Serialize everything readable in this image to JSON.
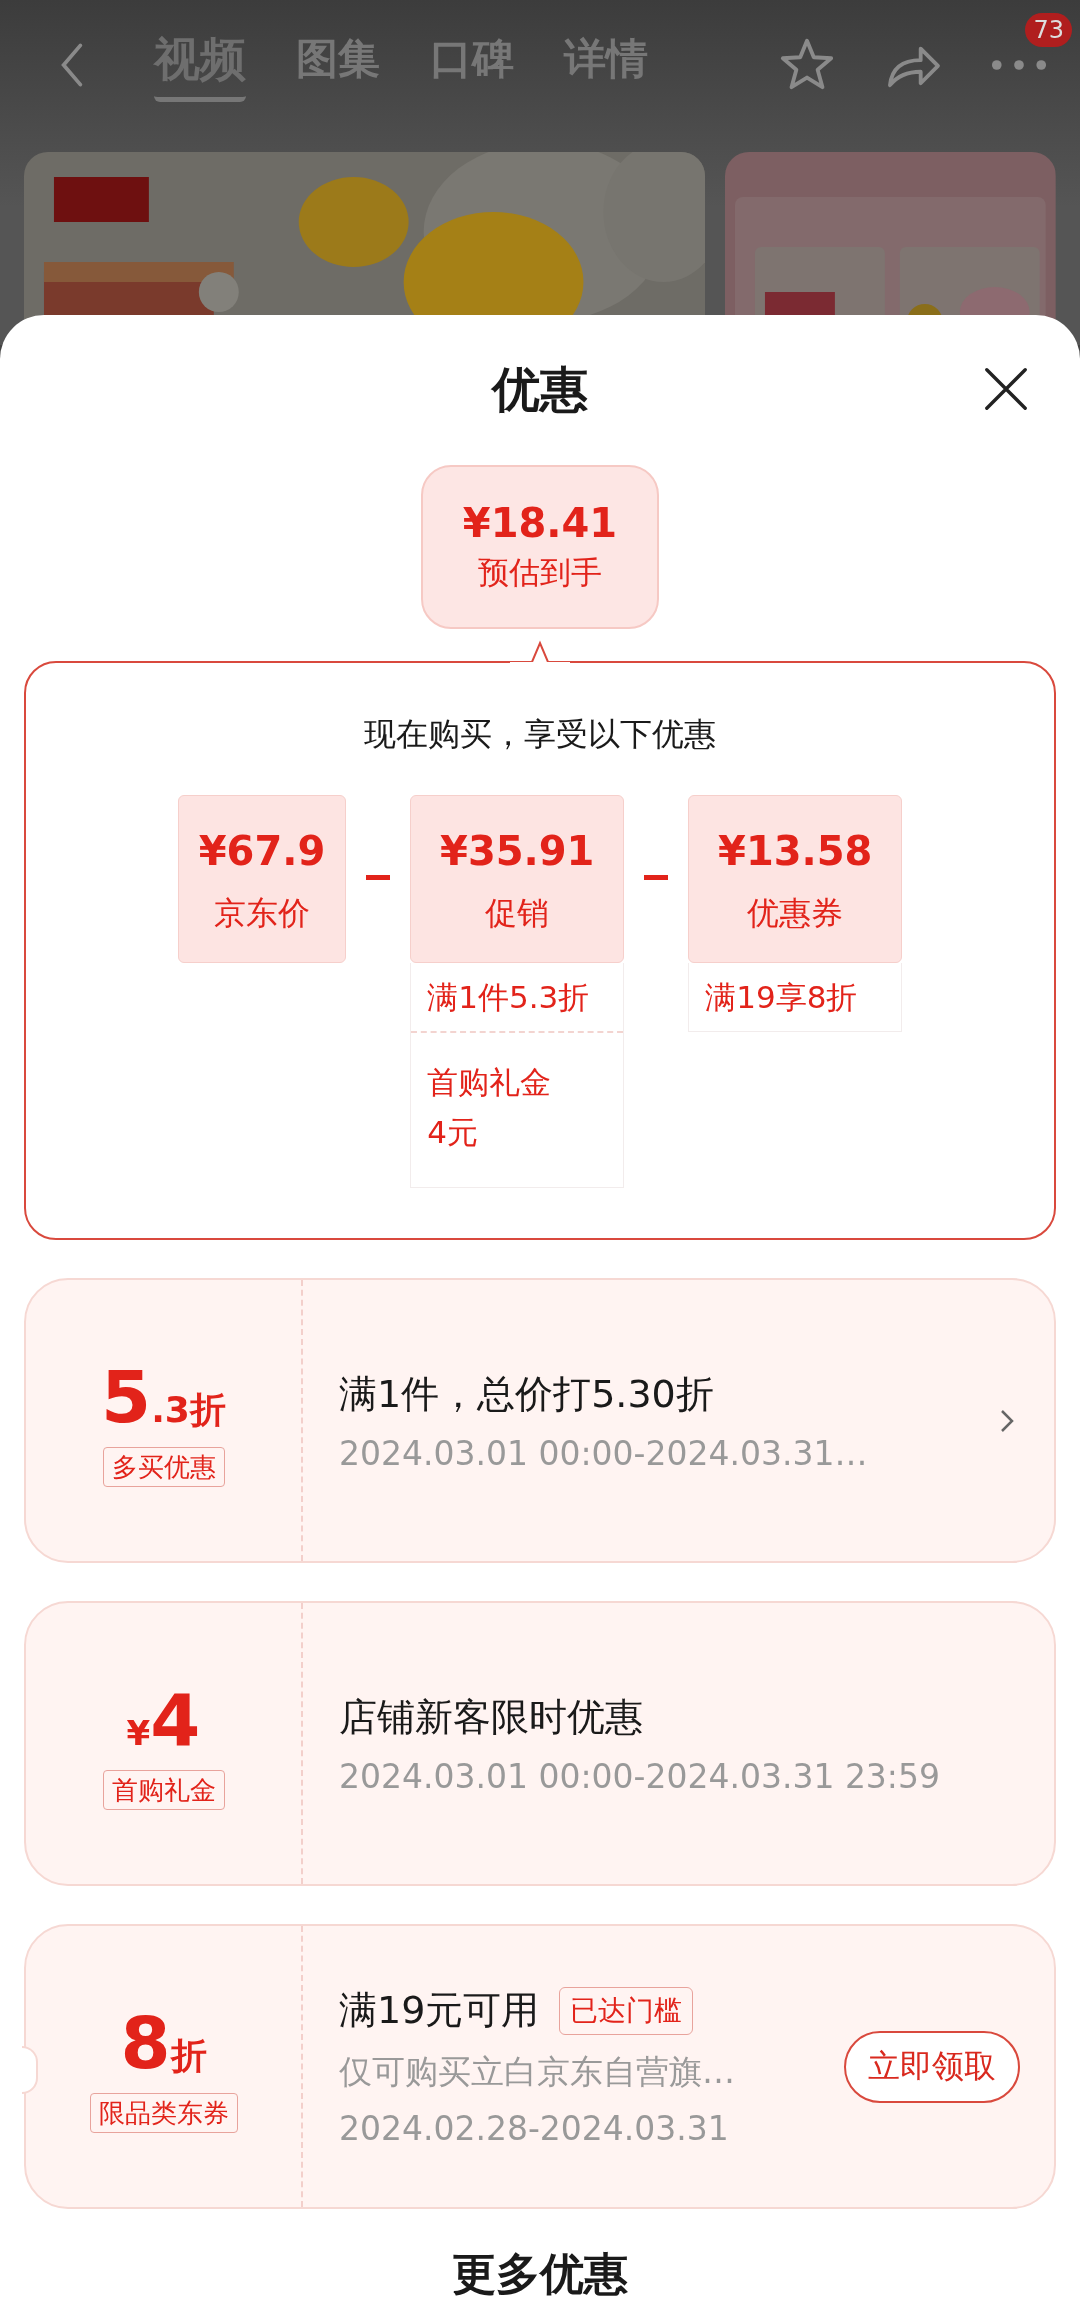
{
  "nav": {
    "tabs": [
      {
        "label": "视频",
        "selected": true
      },
      {
        "label": "图集",
        "selected": false
      },
      {
        "label": "口碑",
        "selected": false
      },
      {
        "label": "详情",
        "selected": false
      }
    ],
    "badge": "73"
  },
  "sheet": {
    "title": "优惠"
  },
  "estimate": {
    "price": "¥18.41",
    "label": "预估到手"
  },
  "breakdown": {
    "heading": "现在购买，享受以下优惠",
    "items": [
      {
        "price": "¥67.9",
        "label": "京东价"
      },
      {
        "price": "¥35.91",
        "label": "促销",
        "details": [
          "满1件5.3折",
          "首购礼金 4元"
        ]
      },
      {
        "price": "¥13.58",
        "label": "优惠券",
        "details": [
          "满19享8折"
        ]
      }
    ]
  },
  "offers": [
    {
      "kind": "link",
      "big": "5",
      "suffix": ".3折",
      "tag": "多买优惠",
      "title": "满1件，总价打5.30折",
      "lines": [
        "2024.03.01 00:00-2024.03.31…"
      ]
    },
    {
      "kind": "plain",
      "prefix": "¥",
      "big": "4",
      "tag": "首购礼金",
      "title": "店铺新客限时优惠",
      "lines": [
        "2024.03.01 00:00-2024.03.31 23:59"
      ]
    },
    {
      "kind": "button",
      "big": "8",
      "suffix": "折",
      "tag": "限品类东券",
      "title": "满19元可用",
      "badge": "已达门槛",
      "lines": [
        "仅可购买立白京东自营旗…",
        "2024.02.28-2024.03.31"
      ],
      "button": "立即领取"
    }
  ],
  "more_title": "更多优惠"
}
